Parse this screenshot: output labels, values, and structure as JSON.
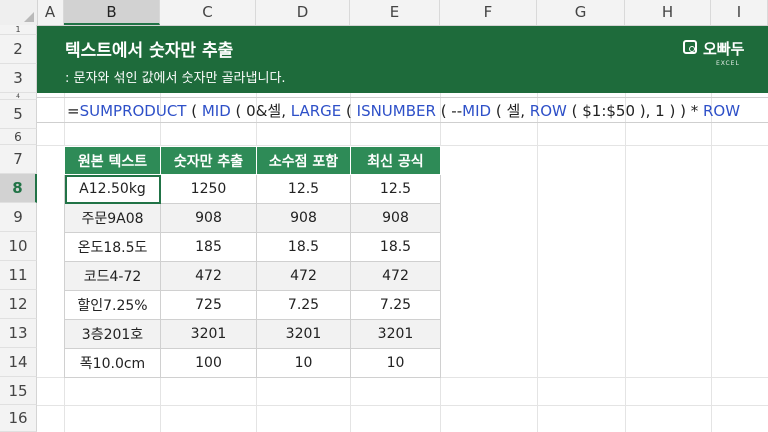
{
  "columns": [
    "A",
    "B",
    "C",
    "D",
    "E",
    "F",
    "G",
    "H",
    "I"
  ],
  "selected_column": "B",
  "rows": [
    "1",
    "2",
    "3",
    "4",
    "5",
    "6",
    "7",
    "8",
    "9",
    "10",
    "11",
    "12",
    "13",
    "14",
    "15",
    "16"
  ],
  "selected_row": "8",
  "banner": {
    "title": "텍스트에서 숫자만 추출",
    "subtitle": ": 문자와 섞인 값에서 숫자만 골라냅니다.",
    "logo_text": "오빠두",
    "logo_sub": "EXCEL"
  },
  "formula": {
    "prefix": "=",
    "parts": [
      {
        "t": "SUMPRODUCT",
        "fn": true
      },
      {
        "t": " ( "
      },
      {
        "t": "MID",
        "fn": true
      },
      {
        "t": " ( 0&셀, "
      },
      {
        "t": "LARGE",
        "fn": true
      },
      {
        "t": " ( "
      },
      {
        "t": "ISNUMBER",
        "fn": true
      },
      {
        "t": " ( --"
      },
      {
        "t": "MID",
        "fn": true
      },
      {
        "t": " ( 셀, "
      },
      {
        "t": "ROW",
        "fn": true
      },
      {
        "t": " ( $1:$50 ), 1 ) ) * "
      },
      {
        "t": "ROW",
        "fn": true
      }
    ]
  },
  "table": {
    "headers": [
      "원본 텍스트",
      "숫자만 추출",
      "소수점 포함",
      "최신 공식"
    ],
    "rows": [
      [
        "A12.50kg",
        "1250",
        "12.5",
        "12.5"
      ],
      [
        "주문9A08",
        "908",
        "908",
        "908"
      ],
      [
        "온도18.5도",
        "185",
        "18.5",
        "18.5"
      ],
      [
        "코드4-72",
        "472",
        "472",
        "472"
      ],
      [
        "할인7.25%",
        "725",
        "7.25",
        "7.25"
      ],
      [
        "3층201호",
        "3201",
        "3201",
        "3201"
      ],
      [
        "폭10.0cm",
        "100",
        "10",
        "10"
      ]
    ]
  },
  "colors": {
    "banner": "#1e6b3b",
    "header": "#2e8b57",
    "accent": "#217346",
    "function": "#2e50c8"
  }
}
